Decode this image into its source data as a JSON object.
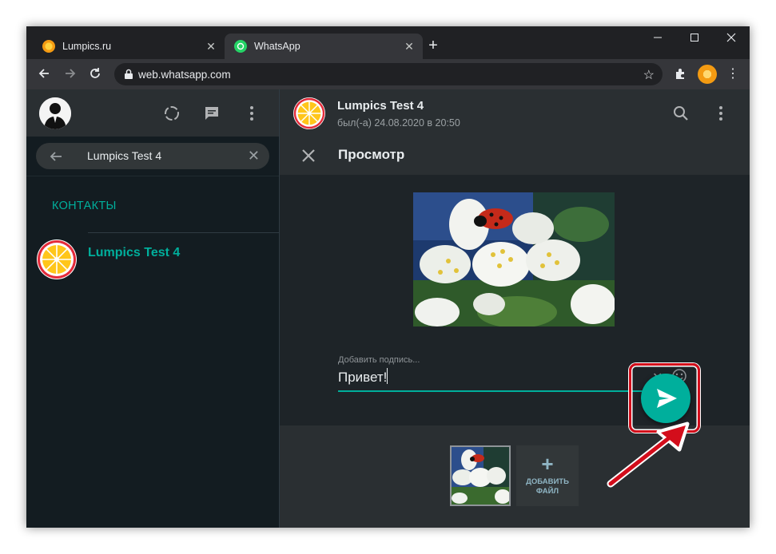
{
  "browser": {
    "tabs": [
      {
        "label": "Lumpics.ru",
        "active": false
      },
      {
        "label": "WhatsApp",
        "active": true
      }
    ],
    "url": "web.whatsapp.com"
  },
  "left_pane": {
    "search": {
      "value": "Lumpics Test 4"
    },
    "section_title": "КОНТАКТЫ",
    "contacts": [
      {
        "name": "Lumpics Test 4"
      }
    ]
  },
  "chat_header": {
    "name": "Lumpics Test 4",
    "status": "был(-а) 24.08.2020 в 20:50"
  },
  "preview": {
    "title": "Просмотр",
    "caption_label": "Добавить подпись...",
    "caption_value": "Привет!",
    "add_file_label_line1": "ДОБАВИТЬ",
    "add_file_label_line2": "ФАЙЛ"
  },
  "colors": {
    "accent": "#00af9c",
    "highlight": "#d30d1b",
    "panel": "#2a2f32",
    "background": "#131c21"
  },
  "icons": [
    "search-icon",
    "menu-dots-icon",
    "status-icon",
    "new-chat-icon",
    "close-icon",
    "emoji-icon",
    "send-icon",
    "back-arrow-icon",
    "reload-icon",
    "lock-icon",
    "star-icon",
    "extensions-icon"
  ]
}
